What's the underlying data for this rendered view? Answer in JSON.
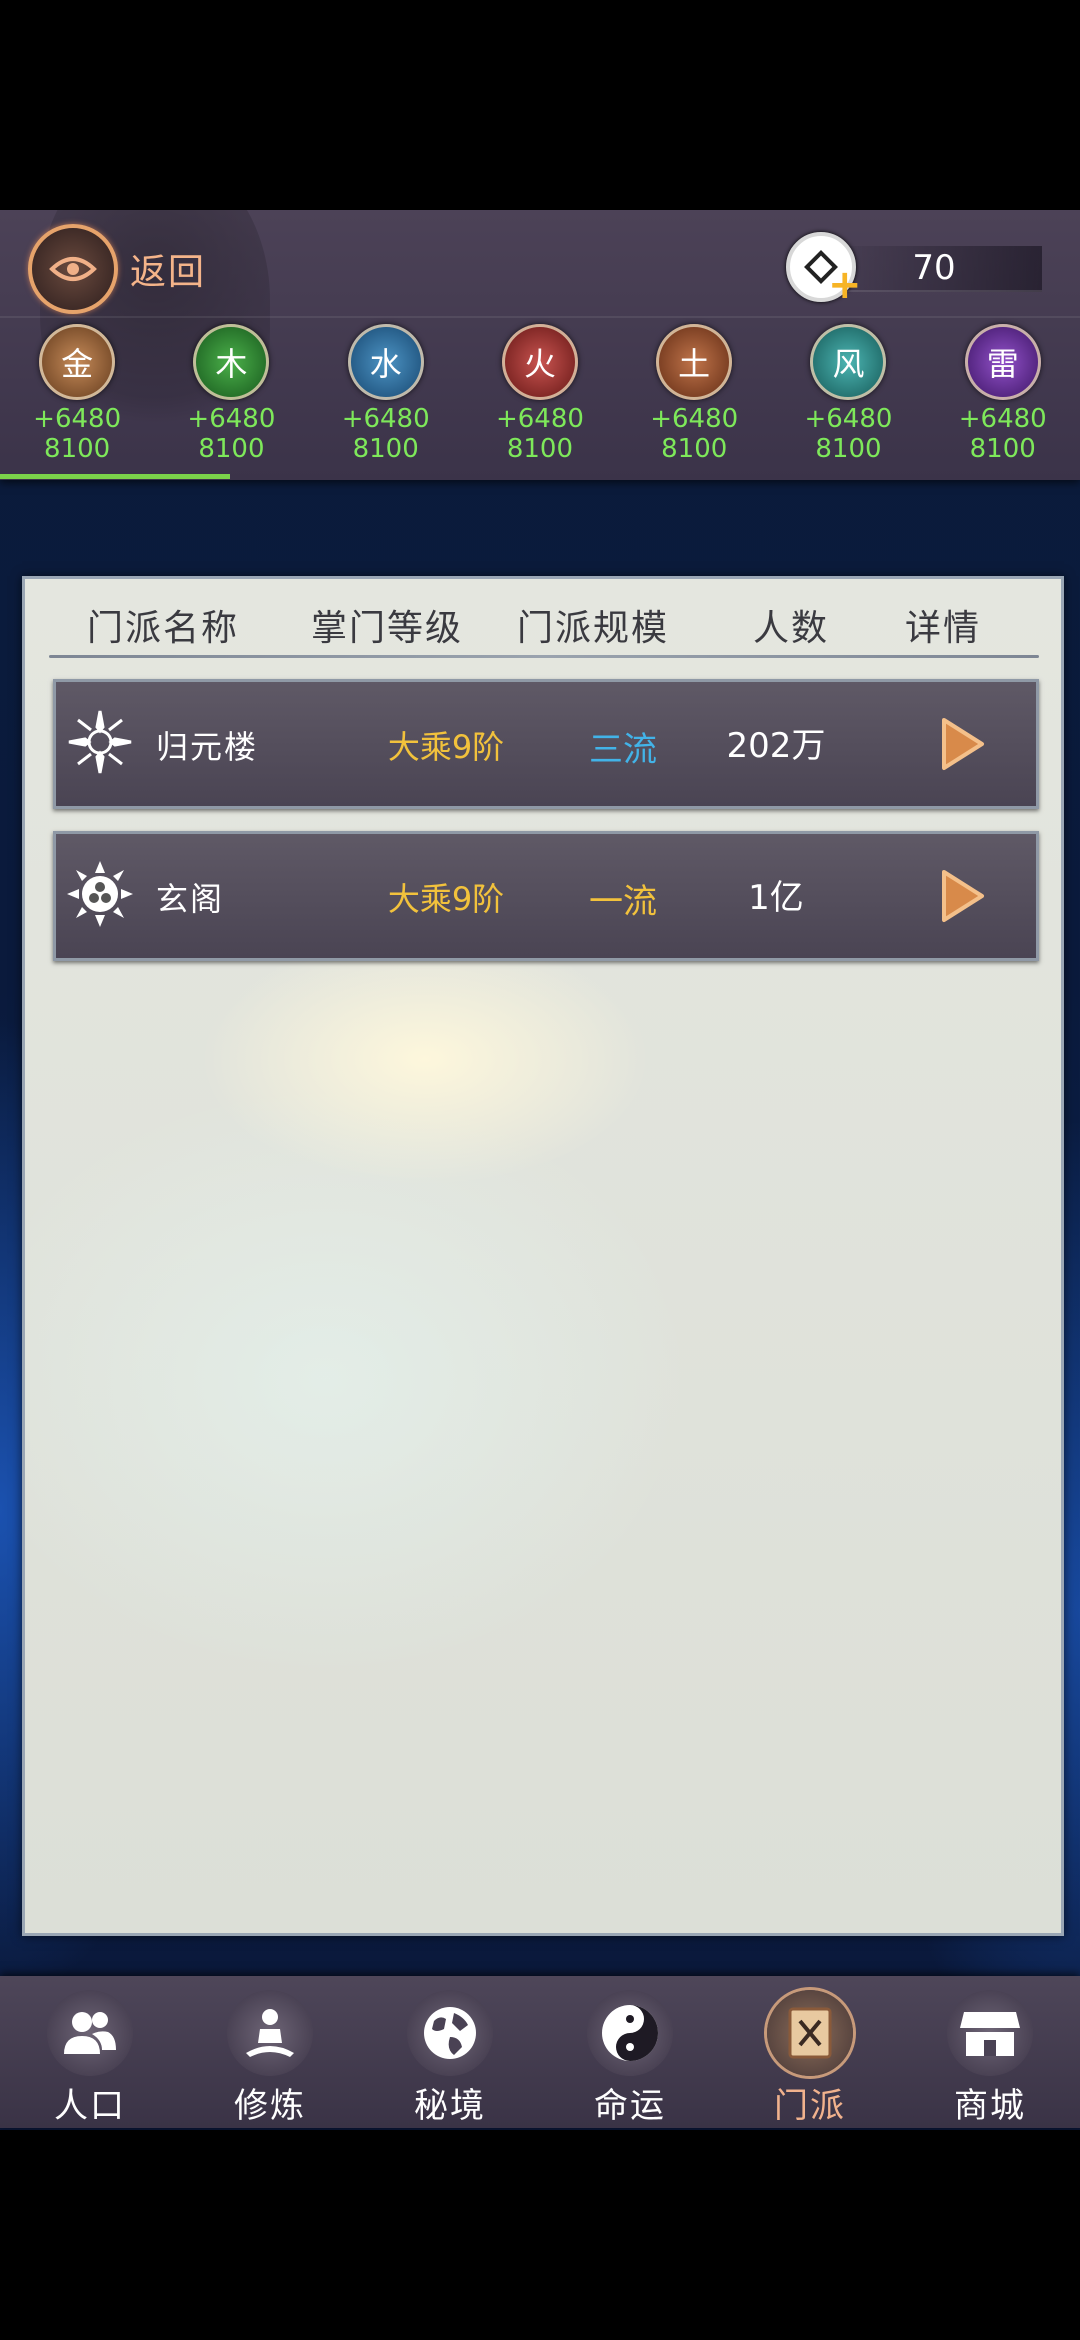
{
  "header": {
    "back_label": "返回",
    "currency_amount": "70"
  },
  "elements": [
    {
      "name": "金",
      "bonus": "+6480",
      "value": "8100",
      "color": "#b27a4a"
    },
    {
      "name": "木",
      "bonus": "+6480",
      "value": "8100",
      "color": "#3d9a3c"
    },
    {
      "name": "水",
      "bonus": "+6480",
      "value": "8100",
      "color": "#3a7fae"
    },
    {
      "name": "火",
      "bonus": "+6480",
      "value": "8100",
      "color": "#b0403c"
    },
    {
      "name": "土",
      "bonus": "+6480",
      "value": "8100",
      "color": "#a9603b"
    },
    {
      "name": "风",
      "bonus": "+6480",
      "value": "8100",
      "color": "#3a9c9a"
    },
    {
      "name": "雷",
      "bonus": "+6480",
      "value": "8100",
      "color": "#7a3fb0"
    }
  ],
  "table": {
    "columns": [
      "门派名称",
      "掌门等级",
      "门派规模",
      "人数",
      "详情"
    ],
    "rows": [
      {
        "name": "归元楼",
        "rank": "大乘9阶",
        "scale": "三流",
        "scale_color": "#42b3e8",
        "members": "202万"
      },
      {
        "name": "玄阁",
        "rank": "大乘9阶",
        "scale": "一流",
        "scale_color": "#f2c23c",
        "members": "1亿"
      }
    ]
  },
  "nav": [
    {
      "label": "人口",
      "icon": "people-icon"
    },
    {
      "label": "修炼",
      "icon": "meditation-icon"
    },
    {
      "label": "秘境",
      "icon": "globe-icon"
    },
    {
      "label": "命运",
      "icon": "yin-yang-icon"
    },
    {
      "label": "门派",
      "icon": "sect-book-icon",
      "active": true
    },
    {
      "label": "商城",
      "icon": "shop-icon"
    }
  ],
  "colors": {
    "accent_green": "#7ee85a",
    "accent_orange": "#f4b48a",
    "rank_gold": "#f2c23c"
  }
}
